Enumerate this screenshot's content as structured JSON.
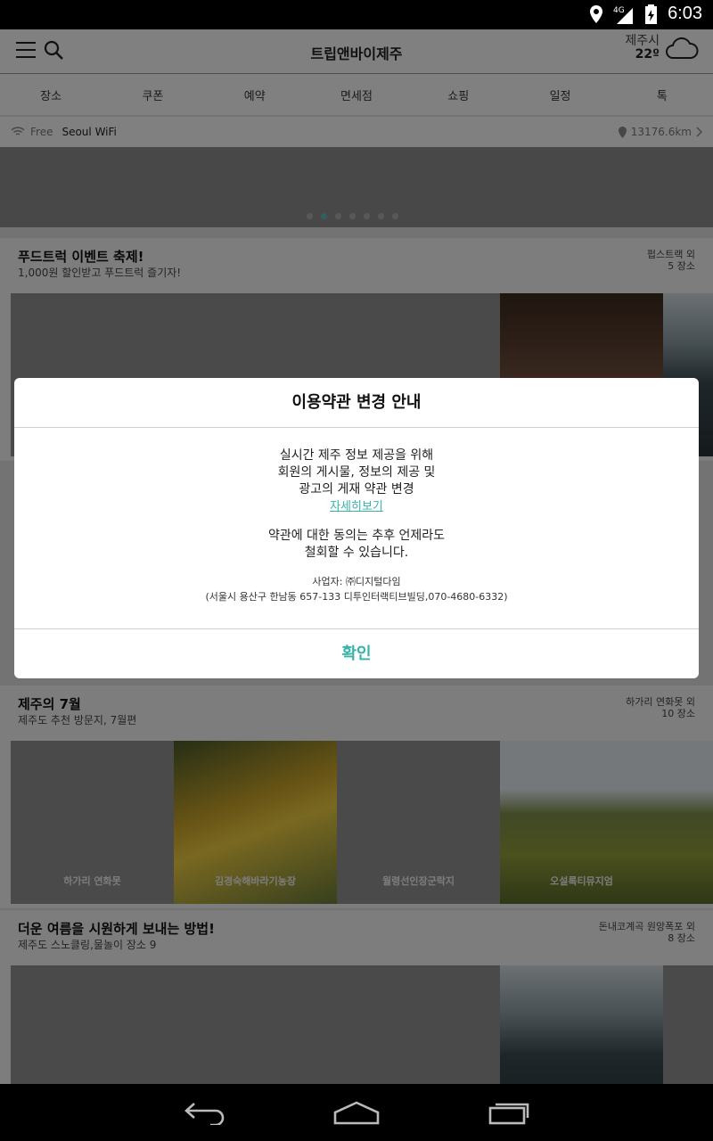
{
  "status_bar": {
    "time": "6:03",
    "network": "4G"
  },
  "app": {
    "title": "트립앤바이제주",
    "weather": {
      "city": "제주시",
      "temp": "22º",
      "icon": "cloud-icon"
    },
    "tabs": [
      "장소",
      "쿠폰",
      "예약",
      "면세점",
      "쇼핑",
      "일정",
      "톡"
    ],
    "wifi": {
      "free": "Free",
      "ssid": "Seoul WiFi",
      "distance": "13176.6km"
    },
    "banner": {
      "dot_count": 7,
      "active_dot": 1
    }
  },
  "sections": [
    {
      "title": "푸드트럭 이벤트 축제!",
      "subtitle": "1,000원 할인받고 푸드트럭 즐기자!",
      "location": "펍스트랙 외",
      "count": "5 장소",
      "thumbs": [
        "",
        "",
        "",
        "",
        ""
      ]
    },
    {
      "title": "제주의 7월",
      "subtitle": "제주도 추천 방문지, 7월편",
      "location": "하가리 연화못 외",
      "count": "10 장소",
      "thumbs": [
        "하가리 연화못",
        "김경숙해바라기농장",
        "월령선인장군락지",
        "오설록티뮤지엄",
        ""
      ]
    },
    {
      "title": "더운 여름을 시원하게 보내는 방법!",
      "subtitle": "제주도 스노클링,물놀이 장소 9",
      "location": "돈내코계곡 원앙폭포 외",
      "count": "8 장소",
      "thumbs": [
        "",
        "",
        "",
        "",
        ""
      ]
    }
  ],
  "dialog": {
    "title": "이용약관 변경 안내",
    "body_lines": [
      "실시간 제주 정보 제공을 위해",
      "회원의 게시물, 정보의 제공 및",
      "광고의 게재 약관 변경"
    ],
    "link": "자세히보기",
    "consent_lines": [
      "약관에 대한 동의는 추후 언제라도",
      "철회할 수 있습니다."
    ],
    "company": "사업자: ㈜디지털다임",
    "address": "(서울시 용산구 한남동 657-133 디투인터랙티브빌딩,070-4680-6332)",
    "confirm": "확인"
  },
  "colors": {
    "accent": "#38b3a9",
    "dim": "rgba(0,0,0,0.48)"
  }
}
